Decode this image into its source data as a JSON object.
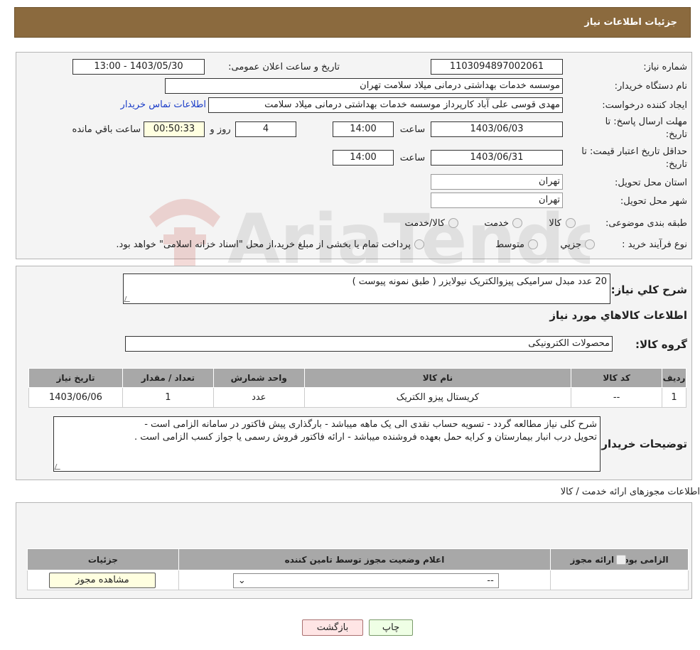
{
  "header": {
    "title": "جزئیات اطلاعات نیاز"
  },
  "form": {
    "need_number_label": "شماره نیاز:",
    "need_number": "1103094897002061",
    "announce_label": "تاریخ و ساعت اعلان عمومی:",
    "announce_value": "1403/05/30 - 13:00",
    "buyer_org_label": "نام دستگاه خریدار:",
    "buyer_org": "موسسه خدمات بهداشتی درمانی میلاد سلامت تهران",
    "creator_label": "ایجاد کننده درخواست:",
    "creator": "مهدی قوسی علی آباد کارپرداز موسسه خدمات بهداشتی درمانی میلاد سلامت",
    "contact_link": "اطلاعات تماس خریدار",
    "deadline_label_1": "مهلت ارسال پاسخ: تا",
    "deadline_label_2": "تاریخ:",
    "deadline_date": "1403/06/03",
    "time_label": "ساعت",
    "deadline_time": "14:00",
    "days": "4",
    "days_label": "روز و",
    "remaining": "00:50:33",
    "remaining_label": "ساعت باقي مانده",
    "validity_label_1": "حداقل تاریخ اعتبار قیمت: تا",
    "validity_label_2": "تاریخ:",
    "validity_date": "1403/06/31",
    "validity_time": "14:00",
    "province_label": "استان محل تحویل:",
    "province": "تهران",
    "city_label": "شهر محل تحویل:",
    "city": "تهران",
    "category_label": "طبقه بندی موضوعی:",
    "category_options": [
      "کالا",
      "خدمت",
      "کالا/خدمت"
    ],
    "process_label": "نوع فرآیند خرید :",
    "process_options": [
      "جزیي",
      "متوسط"
    ],
    "process_note": "پرداخت تمام یا بخشی از مبلغ خرید،از محل \"اسناد خزانه اسلامی\" خواهد بود."
  },
  "watermark": {
    "text": "AriaTender.neT"
  },
  "summary": {
    "desc_label": "شرح کلي نياز:",
    "desc": "20 عدد مبدل سرامیکی پیزوالکتریک نیولایزر ( طبق نمونه پیوست )",
    "goods_title": "اطلاعات کالاهاي مورد نياز",
    "group_label": "گروه کالا:",
    "group": "محصولات الکترونیکی",
    "table_headers": [
      "ردیف",
      "کد کالا",
      "نام کالا",
      "واحد شمارش",
      "تعداد / مقدار",
      "تاریخ نیاز"
    ],
    "table_rows": [
      [
        "1",
        "--",
        "کریستال پیزو الکتریک",
        "عدد",
        "1",
        "1403/06/06"
      ]
    ],
    "buyer_notes_label": "توضیحات خریدار:",
    "buyer_notes_1": "شرح کلی نیاز مطالعه گردد - تسویه حساب نقدی الی یک ماهه میباشد - بارگذاری پیش فاکتور در سامانه الزامی است -",
    "buyer_notes_2": "تحویل درب انبار بیمارستان و کرایه حمل بعهده فروشنده میباشد - ارائه فاکتور فروش رسمی یا جواز کسب الزامی است ."
  },
  "licenses": {
    "title": "اطلاعات مجوزهای ارائه خدمت / کالا",
    "headers": [
      "الزامی بودن ارائه مجوز",
      "اعلام وضعیت مجوز توسط تامین کننده",
      "جزئیات"
    ],
    "select_value": "--",
    "view_button": "مشاهده مجوز"
  },
  "footer": {
    "print": "چاپ",
    "back": "بازگشت"
  }
}
